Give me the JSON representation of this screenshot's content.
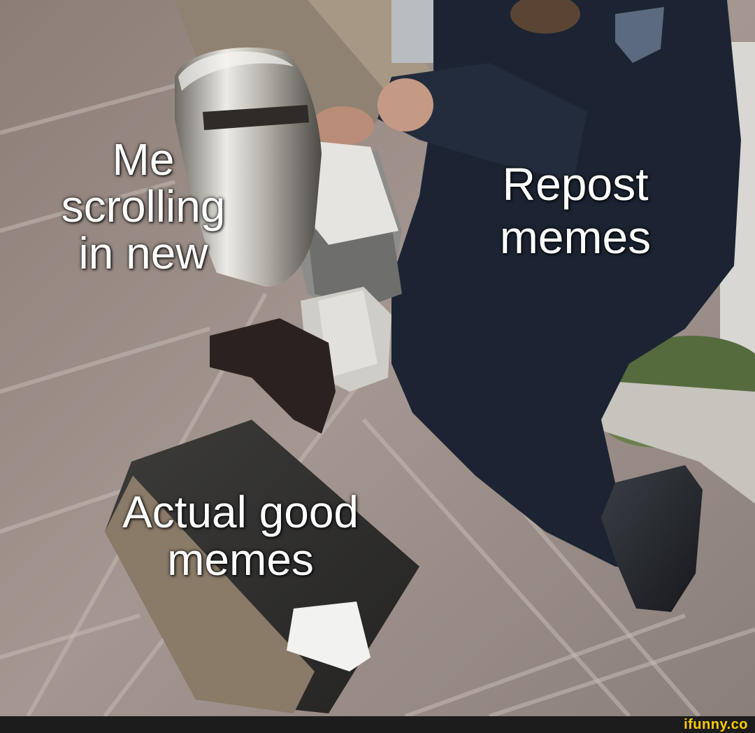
{
  "captions": {
    "me": [
      "Me",
      "scrolling",
      "in new"
    ],
    "repost": [
      "Repost",
      "memes"
    ],
    "actual": [
      "Actual good",
      "memes"
    ]
  },
  "watermark": "ifunny.co",
  "colors": {
    "caption_text": "#ffffff",
    "watermark": "#ffcc00",
    "footer_bar": "#1c1c1c"
  }
}
